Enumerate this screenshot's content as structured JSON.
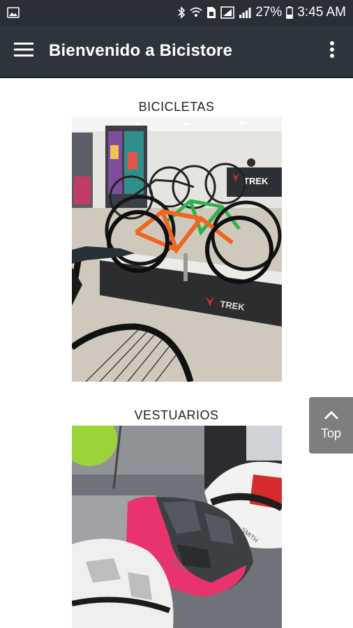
{
  "status_bar": {
    "battery_percent": "27%",
    "time": "3:45 AM",
    "icons": [
      "image-icon",
      "bluetooth-icon",
      "wifi-icon",
      "sim-icon",
      "data-icon",
      "signal-icon",
      "battery-icon"
    ]
  },
  "app_bar": {
    "title": "Bienvenido a Bicistore",
    "menu_icon": "hamburger-menu-icon",
    "overflow_icon": "more-vert-icon"
  },
  "sections": [
    {
      "title": "BICICLETAS",
      "image": "bike-store-photo"
    },
    {
      "title": "VESTUARIOS",
      "image": "helmets-photo"
    }
  ],
  "photo_text": {
    "brand_banner": "TREK",
    "brand_platform": "TREK",
    "helmet_brand": "SMITH"
  },
  "scroll_top": {
    "label": "Top",
    "icon": "chevron-up-icon"
  },
  "colors": {
    "status_bar": "#2a2f35",
    "app_bar": "#2e343b",
    "top_button": "#7c7e80"
  }
}
